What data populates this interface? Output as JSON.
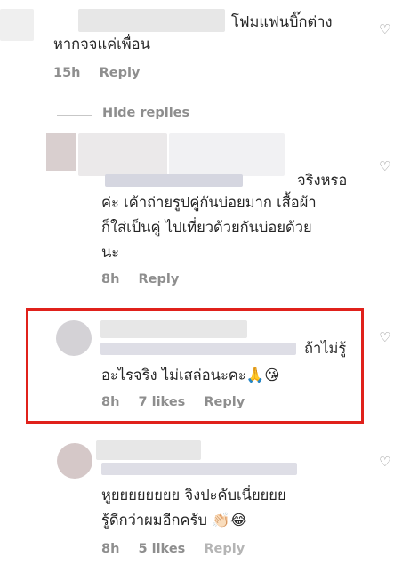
{
  "comments": [
    {
      "line1_tail": "โฟมแฟนบิ๊กต่าง",
      "line2": "หากจจแค่เพื่อน",
      "time": "15h",
      "reply_label": "Reply"
    },
    {
      "line1_tail": "จริงหรอ",
      "line2": "ค่ะ เค้าถ่ายรูปคู่กันบ่อยมาก เสื้อผ้า",
      "line3": "ก็ใส่เป็นคู่ ไปเที่ยวด้วยกันบ่อยด้วย",
      "line4": "นะ",
      "time": "8h",
      "reply_label": "Reply"
    },
    {
      "line1_tail": "ถ้าไม่รู้",
      "line2": "อะไรจริง ไม่เสล่อนะคะ🙏😘",
      "time": "8h",
      "likes": "7 likes",
      "reply_label": "Reply"
    },
    {
      "line1": "หูยยยยยยยย  จิงปะคับเนี่ยยยย",
      "line2": "รู้ดีกว่าผมอีกครับ 👏🏻😂",
      "time": "8h",
      "likes": "5 likes",
      "reply_label": "Reply"
    }
  ],
  "hide_replies_label": "Hide replies",
  "like_icon": "heart-outline-icon",
  "highlight_color": "#e0211b"
}
